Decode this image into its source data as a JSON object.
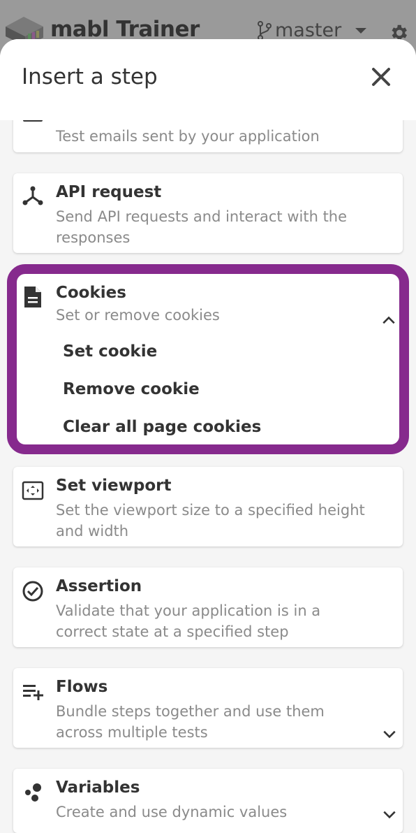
{
  "app": {
    "title": "mabl Trainer",
    "branch": "master",
    "icons": [
      "mabl-logo-icon",
      "branch-icon",
      "caret-down-icon",
      "gear-icon"
    ]
  },
  "modal": {
    "title": "Insert a step",
    "close_icon": "close-icon"
  },
  "steps": {
    "email": {
      "desc": "Test emails sent by your application",
      "icon": "mail-icon"
    },
    "api": {
      "title": "API request",
      "desc": "Send API requests and interact with the responses",
      "icon": "api-icon"
    },
    "cookies": {
      "title": "Cookies",
      "desc": "Set or remove cookies",
      "icon": "document-icon",
      "expanded": true,
      "items": [
        "Set cookie",
        "Remove cookie",
        "Clear all page cookies"
      ]
    },
    "viewport": {
      "title": "Set viewport",
      "desc": "Set the viewport size to a specified height and width",
      "icon": "viewport-icon"
    },
    "assertion": {
      "title": "Assertion",
      "desc": "Validate that your application is in a correct state at a specified step",
      "icon": "check-circle-icon"
    },
    "flows": {
      "title": "Flows",
      "desc": "Bundle steps together and use them across multiple tests",
      "icon": "playlist-add-icon"
    },
    "variables": {
      "title": "Variables",
      "desc": "Create and use dynamic values",
      "icon": "variables-icon"
    }
  },
  "colors": {
    "highlight": "#862a8d",
    "backdrop": "#8a8a8a"
  }
}
